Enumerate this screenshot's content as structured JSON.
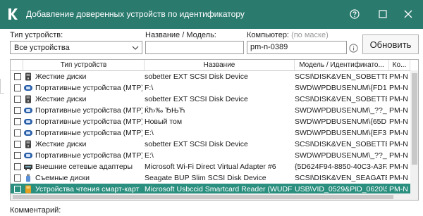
{
  "window": {
    "title": "Добавление доверенных устройств по идентификатору",
    "accent": "#2b7a6e",
    "selected_row_color": "#2b8f7f"
  },
  "filters": {
    "device_type_label": "Тип устройств:",
    "device_type_value": "Все устройства",
    "name_model_label": "Название / Модель:",
    "name_model_value": "",
    "computer_label": "Компьютер:",
    "computer_hint": "(по маске)",
    "computer_value": "pm-n-0389",
    "update_button": "Обновить"
  },
  "table": {
    "headers": [
      "Тип устройств",
      "Название",
      "Модель / Идентификато...",
      "Ко..."
    ],
    "rows": [
      {
        "type": "Жесткие диски",
        "icon": "hdd-icon",
        "name": "sobetter EXT SCSI Disk Device",
        "model": "SCSI\\DISK&VEN_SOBETTER&...",
        "computer": "PM-N"
      },
      {
        "type": "Портативные устройства (MTP)",
        "icon": "portable-device-icon",
        "name": "F:\\",
        "model": "SWD\\WPDBUSENUM\\{FD1B...",
        "computer": "PM-N"
      },
      {
        "type": "Жесткие диски",
        "icon": "hdd-icon",
        "name": "sobetter EXT SCSI Disk Device",
        "model": "SCSI\\DISK&VEN_SOBETTER&...",
        "computer": "PM-N"
      },
      {
        "type": "Портативные устройства (MTP)",
        "icon": "portable-device-icon",
        "name": "Ќћ›‰ ЂЊЋ",
        "model": "SWD\\WPDBUSENUM\\_??_U...",
        "computer": "PM-N"
      },
      {
        "type": "Портативные устройства (MTP)",
        "icon": "portable-device-icon",
        "name": "Новый том",
        "model": "SWD\\WPDBUSENUM\\{65DE...",
        "computer": "PM-N"
      },
      {
        "type": "Портативные устройства (MTP)",
        "icon": "portable-device-icon",
        "name": "E:\\",
        "model": "SWD\\WPDBUSENUM\\{EF3D...",
        "computer": "PM-N"
      },
      {
        "type": "Жесткие диски",
        "icon": "hdd-icon",
        "name": "sobetter EXT SCSI Disk Device",
        "model": "SCSI\\DISK&VEN_SOBETTER&...",
        "computer": "PM-N"
      },
      {
        "type": "Портативные устройства (MTP)",
        "icon": "portable-device-icon",
        "name": "E:\\",
        "model": "SWD\\WPDBUSENUM\\_??_U...",
        "computer": "PM-N"
      },
      {
        "type": "Внешние сетевые адаптеры",
        "icon": "network-adapter-icon",
        "name": "Microsoft Wi-Fi Direct Virtual Adapter #6",
        "model": "{5D624F94-8850-40C3-A3FA-...",
        "computer": "PM-N"
      },
      {
        "type": "Съемные диски",
        "icon": "removable-drive-icon",
        "name": "Seagate BUP Slim SCSI Disk Device",
        "model": "SCSI\\DISK&VEN_SEAGATE&P...",
        "computer": "PM-N"
      },
      {
        "type": "Устройства чтения смарт-карт",
        "icon": "smart-card-reader-icon",
        "name": "Microsoft Usbccid Smartcard Reader (WUDF)",
        "model": "USB\\VID_0529&PID_0620\\5...",
        "computer": "PM-N",
        "selected": true
      }
    ]
  },
  "comment": {
    "label": "Комментарий:"
  }
}
